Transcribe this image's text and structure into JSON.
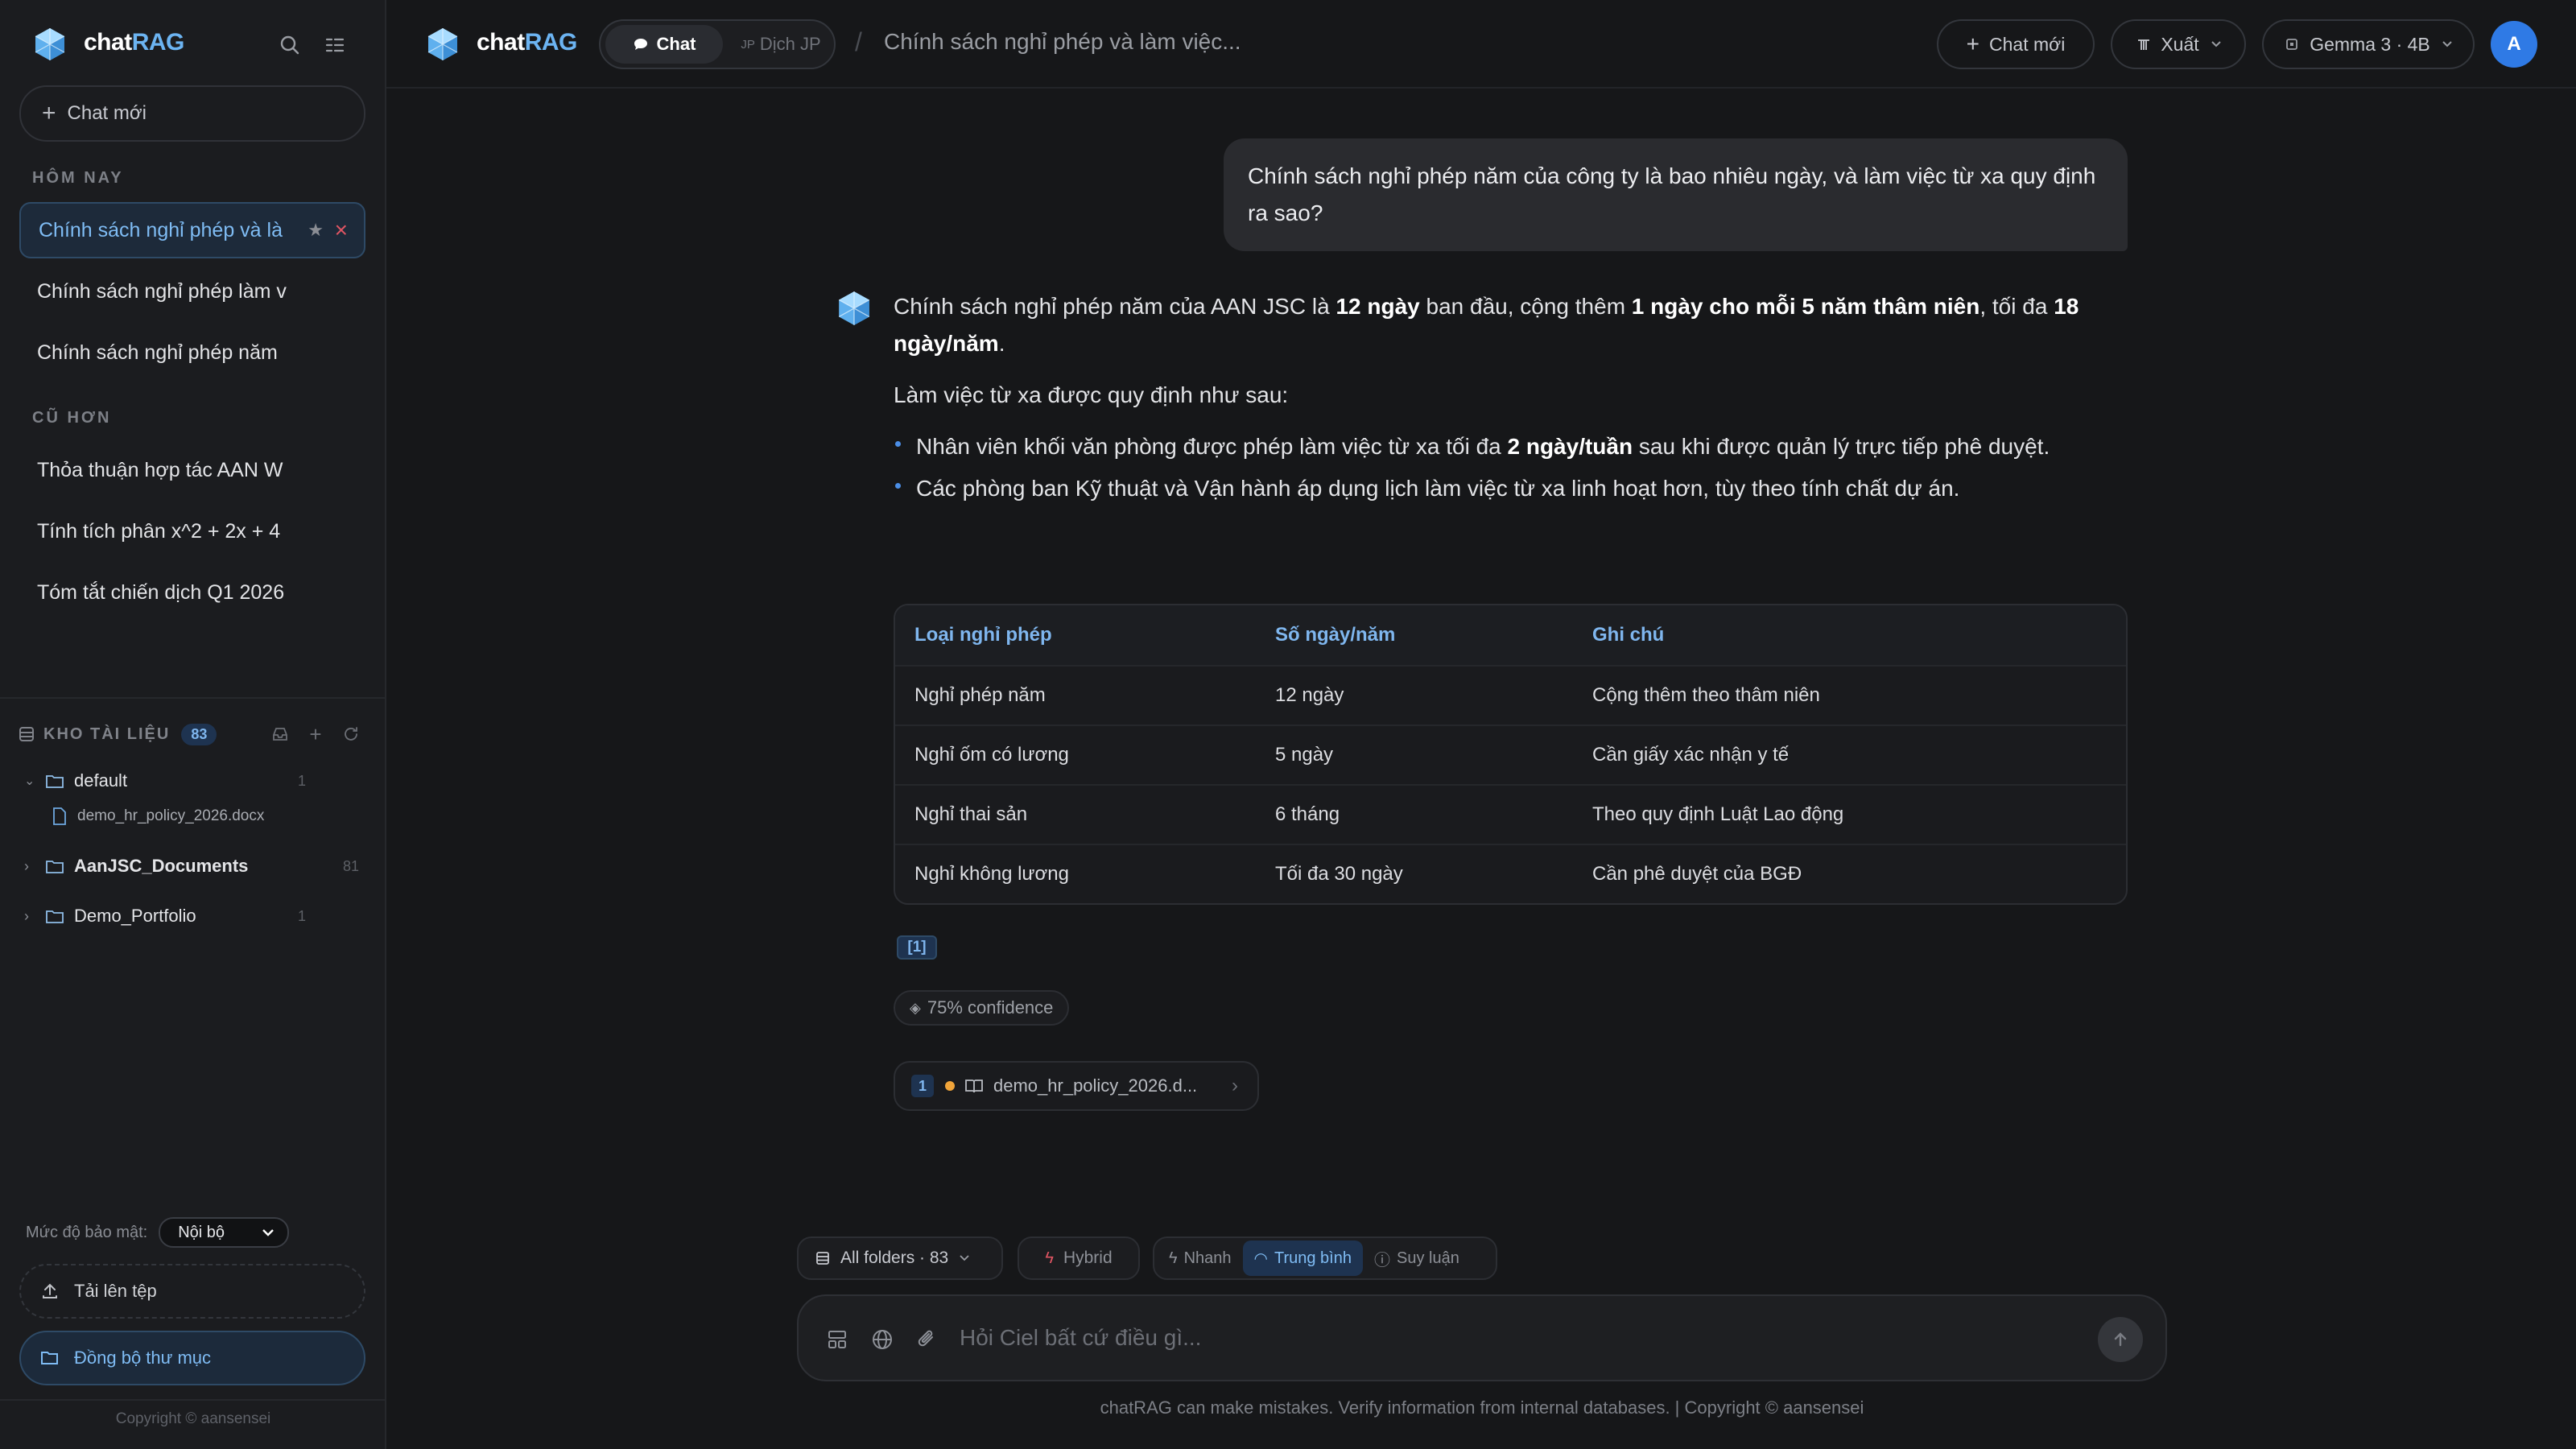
{
  "app": {
    "name_left": "chat",
    "name_right": "RAG"
  },
  "sidebar": {
    "new_chat_label": "Chat mới",
    "today_label": "HÔM NAY",
    "older_label": "CŨ HƠN",
    "today_items": [
      {
        "label": "Chính sách nghỉ phép và là"
      },
      {
        "label": "Chính sách nghỉ phép làm v"
      },
      {
        "label": "Chính sách nghỉ phép năm"
      }
    ],
    "older_items": [
      {
        "label": "Thỏa thuận hợp tác AAN W"
      },
      {
        "label": "Tính tích phân x^2 + 2x + 4"
      },
      {
        "label": "Tóm tắt chiến dịch Q1 2026"
      }
    ],
    "library": {
      "title": "KHO TÀI LIỆU",
      "count": "83",
      "folders": [
        {
          "name": "default",
          "count": "1",
          "expanded": true,
          "files": [
            "demo_hr_policy_2026.docx"
          ]
        },
        {
          "name": "AanJSC_Documents",
          "count": "81",
          "expanded": false
        },
        {
          "name": "Demo_Portfolio",
          "count": "1",
          "expanded": false
        }
      ]
    },
    "security_label": "Mức độ bảo mật:",
    "security_value": "Nội bộ",
    "upload_label": "Tải lên tệp",
    "sync_label": "Đồng bộ thư mục",
    "copyright": "Copyright © aansensei"
  },
  "topbar": {
    "tab_chat": "Chat",
    "tab_translate": "Dịch JP",
    "tab_translate_prefix": "JP",
    "breadcrumb": "Chính sách nghỉ phép và làm việc...",
    "new_chat": "Chat mới",
    "export": "Xuất",
    "model": "Gemma 3 · 4B",
    "avatar_initial": "A"
  },
  "conversation": {
    "user_message": "Chính sách nghỉ phép năm của công ty là bao nhiêu ngày, và làm việc từ xa quy định ra sao?",
    "answer": {
      "p1_a": "Chính sách nghỉ phép năm của AAN JSC là ",
      "p1_b": "12 ngày",
      "p1_c": " ban đầu, cộng thêm ",
      "p1_d": "1 ngày cho mỗi 5 năm thâm niên",
      "p1_e": ", tối đa ",
      "p1_f": "18 ngày/năm",
      "p1_g": ".",
      "p2": "Làm việc từ xa được quy định như sau:",
      "b1_a": "Nhân viên khối văn phòng được phép làm việc từ xa tối đa ",
      "b1_b": "2 ngày/tuần",
      "b1_c": " sau khi được quản lý trực tiếp phê duyệt.",
      "b2": "Các phòng ban Kỹ thuật và Vận hành áp dụng lịch làm việc từ xa linh hoạt hơn, tùy theo tính chất dự án."
    },
    "table": {
      "headers": [
        "Loại nghỉ phép",
        "Số ngày/năm",
        "Ghi chú"
      ],
      "rows": [
        [
          "Nghỉ phép năm",
          "12 ngày",
          "Cộng thêm theo thâm niên"
        ],
        [
          "Nghỉ ốm có lương",
          "5 ngày",
          "Cần giấy xác nhận y tế"
        ],
        [
          "Nghỉ thai sản",
          "6 tháng",
          "Theo quy định Luật Lao động"
        ],
        [
          "Nghỉ không lương",
          "Tối đa 30 ngày",
          "Cần phê duyệt của BGĐ"
        ]
      ]
    },
    "citation": "[1]",
    "confidence": "75% confidence",
    "source": {
      "num": "1",
      "name": "demo_hr_policy_2026.d..."
    }
  },
  "composer": {
    "folders": "All folders · 83",
    "hybrid": "Hybrid",
    "modes": [
      "Nhanh",
      "Trung bình",
      "Suy luận"
    ],
    "active_mode": "Trung bình",
    "placeholder": "Hỏi Ciel bất cứ điều gì...",
    "disclaimer": "chatRAG can make mistakes. Verify information from internal databases. | Copyright © aansensei"
  },
  "colors": {
    "accent": "#6cb4f2",
    "active_bg": "#1e3350",
    "danger": "#e05563",
    "dot": "#f0a43a",
    "avatar": "#2f7ae5"
  }
}
